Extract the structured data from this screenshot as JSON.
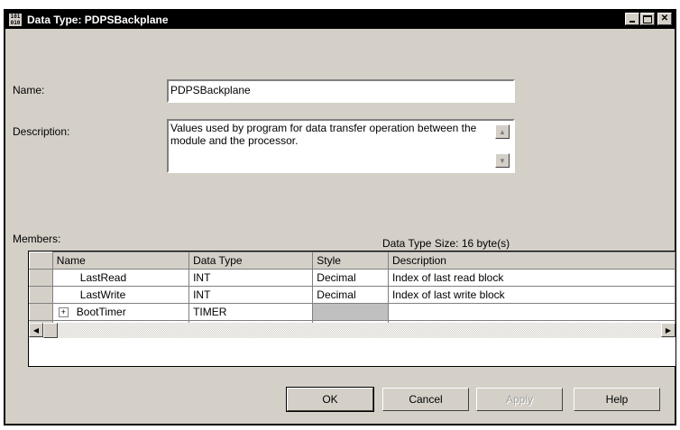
{
  "window": {
    "title": "Data Type: PDPSBackplane",
    "icon_text": "101 010"
  },
  "form": {
    "name_label": "Name:",
    "name_value": "PDPSBackplane",
    "description_label": "Description:",
    "description_value": "Values used by program for data transfer operation between the module and the processor.",
    "members_label": "Members:",
    "size_text": "Data Type Size: 16 byte(s)"
  },
  "table": {
    "columns": [
      "Name",
      "Data Type",
      "Style",
      "Description"
    ],
    "rows": [
      {
        "name": "LastRead",
        "data_type": "INT",
        "style": "Decimal",
        "description": "Index of last read block"
      },
      {
        "name": "LastWrite",
        "data_type": "INT",
        "style": "Decimal",
        "description": "Index of last write block"
      },
      {
        "name": "BootTimer",
        "data_type": "TIMER",
        "style": "",
        "description": "",
        "expander": "+"
      }
    ],
    "new_row_marker": "*"
  },
  "buttons": {
    "ok": "OK",
    "cancel": "Cancel",
    "apply": "Apply",
    "help": "Help"
  }
}
